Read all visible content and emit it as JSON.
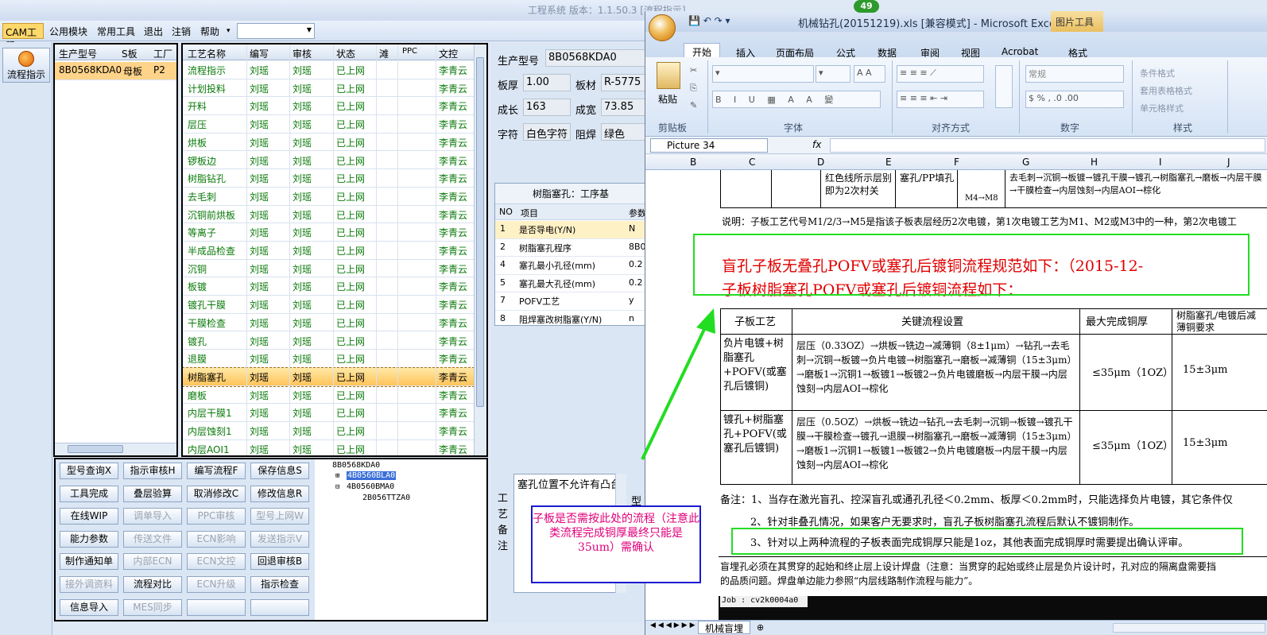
{
  "app": {
    "title": "工程系统  版本：1.1.50.3  [流程指示]",
    "menus": [
      "CAM工程",
      "公用模块",
      "常用工具",
      "退出",
      "注销",
      "帮助"
    ],
    "left_button": "流程指示"
  },
  "product_grid": {
    "headers": [
      "生产型号",
      "S板",
      "工厂"
    ],
    "rows": [
      {
        "model": "8B0568KDA0",
        "board": "母板",
        "factory": "P2"
      }
    ]
  },
  "process_grid": {
    "headers": [
      "工艺名称",
      "编写",
      "审核",
      "状态",
      "滩",
      "PPC",
      "文控"
    ],
    "selected_index": 17,
    "rows": [
      [
        "流程指示",
        "刘瑶",
        "刘瑶",
        "已上网",
        "李青云"
      ],
      [
        "计划投料",
        "刘瑶",
        "刘瑶",
        "已上网",
        "李青云"
      ],
      [
        "开料",
        "刘瑶",
        "刘瑶",
        "已上网",
        "李青云"
      ],
      [
        "层压",
        "刘瑶",
        "刘瑶",
        "已上网",
        "李青云"
      ],
      [
        "烘板",
        "刘瑶",
        "刘瑶",
        "已上网",
        "李青云"
      ],
      [
        "锣板边",
        "刘瑶",
        "刘瑶",
        "已上网",
        "李青云"
      ],
      [
        "树脂钻孔",
        "刘瑶",
        "刘瑶",
        "已上网",
        "李青云"
      ],
      [
        "去毛刺",
        "刘瑶",
        "刘瑶",
        "已上网",
        "李青云"
      ],
      [
        "沉铜前烘板",
        "刘瑶",
        "刘瑶",
        "已上网",
        "李青云"
      ],
      [
        "等离子",
        "刘瑶",
        "刘瑶",
        "已上网",
        "李青云"
      ],
      [
        "半成品检查",
        "刘瑶",
        "刘瑶",
        "已上网",
        "李青云"
      ],
      [
        "沉铜",
        "刘瑶",
        "刘瑶",
        "已上网",
        "李青云"
      ],
      [
        "板镀",
        "刘瑶",
        "刘瑶",
        "已上网",
        "李青云"
      ],
      [
        "镀孔干膜",
        "刘瑶",
        "刘瑶",
        "已上网",
        "李青云"
      ],
      [
        "干膜检查",
        "刘瑶",
        "刘瑶",
        "已上网",
        "李青云"
      ],
      [
        "镀孔",
        "刘瑶",
        "刘瑶",
        "已上网",
        "李青云"
      ],
      [
        "退膜",
        "刘瑶",
        "刘瑶",
        "已上网",
        "李青云"
      ],
      [
        "树脂塞孔",
        "刘瑶",
        "刘瑶",
        "已上网",
        "李青云"
      ],
      [
        "磨板",
        "刘瑶",
        "刘瑶",
        "已上网",
        "李青云"
      ],
      [
        "内层干膜1",
        "刘瑶",
        "刘瑶",
        "已上网",
        "李青云"
      ],
      [
        "内层蚀刻1",
        "刘瑶",
        "刘瑶",
        "已上网",
        "李青云"
      ],
      [
        "内层AOI1",
        "刘瑶",
        "刘瑶",
        "已上网",
        "李青云"
      ]
    ]
  },
  "buttons": [
    [
      "型号查询X",
      "指示审核H",
      "编写流程F",
      "保存信息S"
    ],
    [
      "工具完成",
      "叠层验算",
      "取消修改C",
      "修改信息R"
    ],
    [
      "在线WIP",
      "调单导入",
      "PPC审核",
      "型号上网W"
    ],
    [
      "能力参数",
      "传送文件",
      "ECN影响",
      "发送指示V"
    ],
    [
      "制作通知单",
      "内部ECN",
      "ECN文控",
      "回退审核B"
    ],
    [
      "接外调资料",
      "流程对比",
      "ECN升级",
      "指示检查"
    ],
    [
      "信息导入",
      "MES同步",
      "",
      ""
    ]
  ],
  "tree": [
    "8B0568KDA0",
    "4B0560BLA0",
    "4B0560BMA0",
    "2B056TTZA0"
  ],
  "detail": {
    "model_label": "生产型号",
    "model": "8B0568KDA0",
    "thick_label": "板厚",
    "thick": "1.00",
    "material_label": "板材",
    "material": "R-5775",
    "length_label": "成长",
    "length": "163",
    "width_label": "成宽",
    "width": "73.85",
    "char_label": "字符",
    "char": "白色字符",
    "mask_label": "阻焊",
    "mask": "绿色"
  },
  "param_table": {
    "title": "树脂塞孔：工序基",
    "headers": [
      "NO",
      "项目",
      "参数"
    ],
    "rows": [
      [
        "1",
        "是否导电(Y/N)",
        "N"
      ],
      [
        "2",
        "树脂塞孔程序",
        "8B0"
      ],
      [
        "4",
        "塞孔最小孔径(mm)",
        "0.2"
      ],
      [
        "5",
        "塞孔最大孔径(mm)",
        "0.2"
      ],
      [
        "7",
        "POFV工艺",
        "y"
      ],
      [
        "8",
        "阻焊塞改树脂塞(Y/N)",
        "n"
      ]
    ]
  },
  "remark": {
    "side_label": "工\n艺\n备\n注",
    "text": "塞孔位置不允许有凸台",
    "extra": "型"
  },
  "annotation": "子板是否需按此处的流程（注意此类流程完成铜厚最终只能是35um）需确认",
  "badge": "49",
  "excel": {
    "title": "机械钻孔(20151219).xls  [兼容模式] - Microsoft Excel",
    "context_tab": "图片工具",
    "tabs": [
      "开始",
      "插入",
      "页面布局",
      "公式",
      "数据",
      "审阅",
      "视图",
      "Acrobat",
      "格式"
    ],
    "groups": [
      "剪贴板",
      "字体",
      "对齐方式",
      "数字",
      "样式"
    ],
    "paste": "粘贴",
    "number_format": "常规",
    "style_items": [
      "条件格式",
      "套用表格格式",
      "单元格样式"
    ],
    "namebox": "Picture 34",
    "columns": [
      "B",
      "C",
      "D",
      "E",
      "F",
      "G",
      "H",
      "I",
      "J"
    ],
    "sheet_tab": "机械盲埋",
    "doc": {
      "top_cell1": "红色线所示层别即为2次村关",
      "top_cell2": "塞孔/PP填孔",
      "top_cell3": "M4→M8",
      "top_cell4": "去毛刺→沉铜→板镀→镀孔干膜→镀孔→树脂塞孔→磨板→内层干膜→干膜检查→内层蚀刻→内层AOI→棕化",
      "note": "说明：子板工艺代号M1/2/3→M5是指该子板表层经历2次电镀，第1次电镀工艺为M1、M2或M3中的一种，第2次电镀工",
      "heading1": "盲孔子板无叠孔POFV或塞孔后镀铜流程规范如下：（2015-12-",
      "heading2": "子板树脂塞孔POFV或塞孔后镀铜流程如下：",
      "t_headers": [
        "子板工艺",
        "关键流程设置",
        "最大完成铜厚",
        "树脂塞孔/电镀后减薄铜要求"
      ],
      "t_row1_a": "负片电镀+树脂塞孔+POFV(或塞孔后镀铜)",
      "t_row1_b": "层压（0.33OZ）→烘板→铣边→减薄铜（8±1μm）→钻孔→去毛刺→沉铜→板镀→负片电镀→树脂塞孔→磨板→减薄铜（15±3μm）→磨板1→沉铜1→板镀1→板镀2→负片电镀磨板→内层干膜→内层蚀刻→内层AOI→棕化",
      "t_row1_c": "≤35μm（1OZ）",
      "t_row1_d": "15±3μm",
      "t_row2_a": "镀孔+树脂塞孔+POFV(或塞孔后镀铜)",
      "t_row2_b": "层压（0.5OZ）→烘板→铣边→钻孔→去毛刺→沉铜→板镀→镀孔干膜→干膜检查→镀孔→退膜→树脂塞孔→磨板→减薄铜（15±3μm）→磨板1→沉铜1→板镀1→板镀2→负片电镀磨板→内层干膜→内层蚀刻→内层AOI→棕化",
      "t_row2_c": "≤35μm（1OZ）",
      "t_row2_d": "15±3μm",
      "rem1": "备注：1、当存在激光盲孔、控深盲孔或通孔孔径＜0.2mm、板厚＜0.2mm时，只能选择负片电镀，其它条件仅",
      "rem2": "2、针对非叠孔情况，如果客户无要求时，盲孔子板树脂塞孔流程后默认不镀铜制作。",
      "rem3": "3、针对以上两种流程的子板表面完成铜厚只能是1oz，其他表面完成铜厚时需要提出确认评审。",
      "bottom1": "盲埋孔必须在其贯穿的起始和终止层上设计焊盘（注意：当贯穿的起始或终止层是负片设计时，孔对应的隔离盘需要挡",
      "bottom2": "的品质问题。焊盘单边能力参照“内层线路制作流程与能力”。",
      "job": "Job : cv2k0004a0"
    }
  }
}
